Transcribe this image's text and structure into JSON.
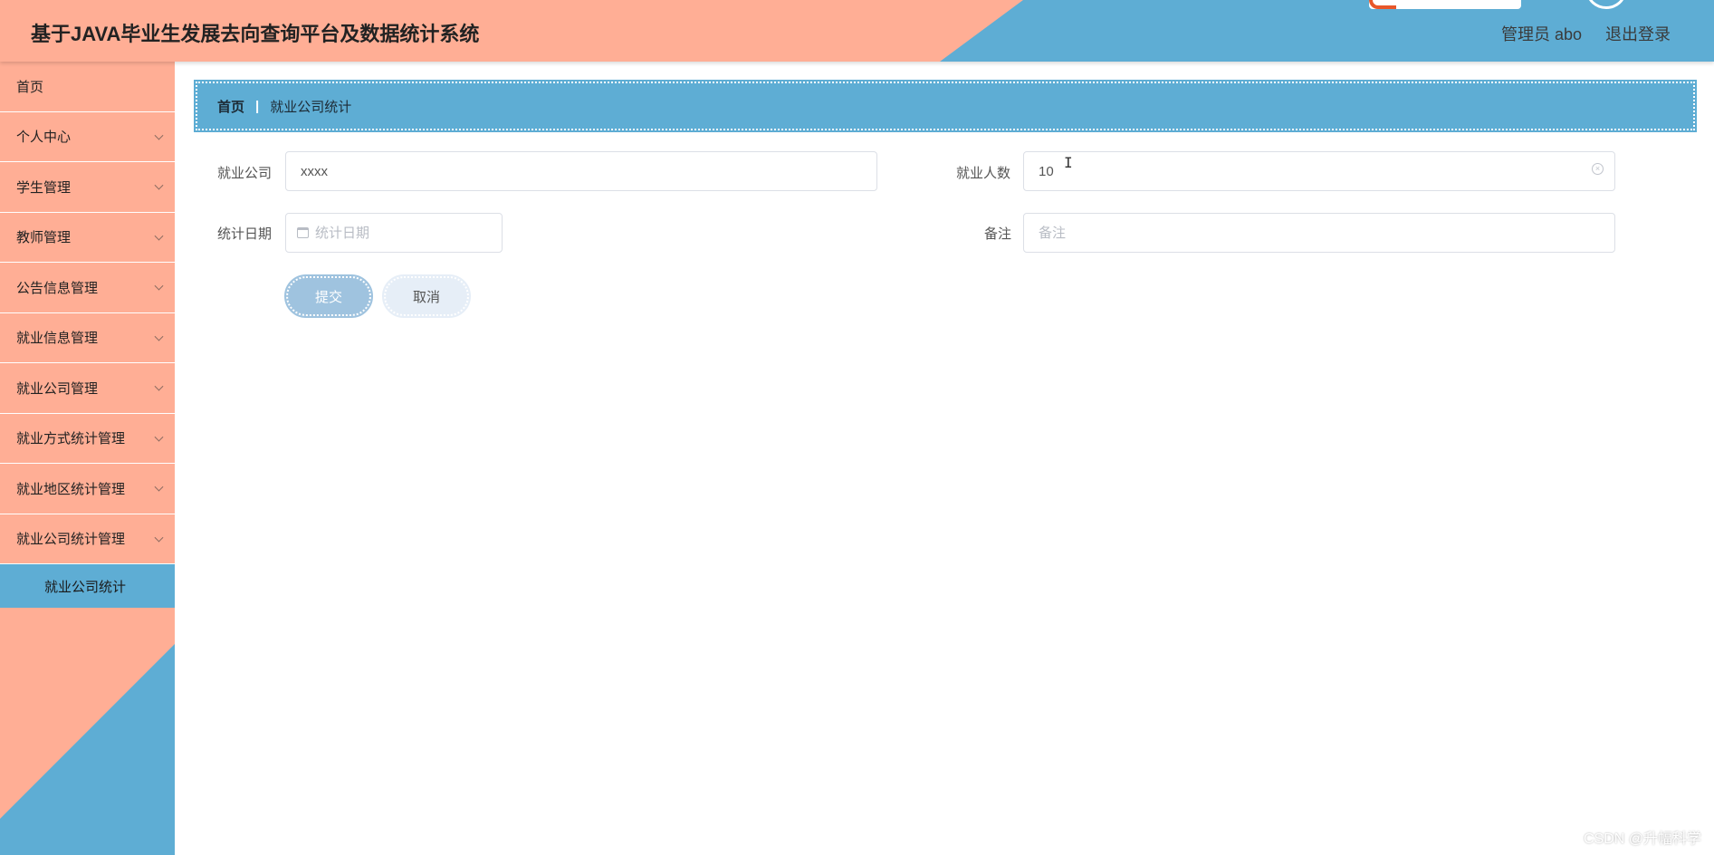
{
  "header": {
    "title": "基于JAVA毕业生发展去向查询平台及数据统计系统",
    "user_label": "管理员 abo",
    "logout_label": "退出登录"
  },
  "sidebar": {
    "items": [
      {
        "label": "首页",
        "has_chevron": false
      },
      {
        "label": "个人中心",
        "has_chevron": true
      },
      {
        "label": "学生管理",
        "has_chevron": true
      },
      {
        "label": "教师管理",
        "has_chevron": true
      },
      {
        "label": "公告信息管理",
        "has_chevron": true
      },
      {
        "label": "就业信息管理",
        "has_chevron": true
      },
      {
        "label": "就业公司管理",
        "has_chevron": true
      },
      {
        "label": "就业方式统计管理",
        "has_chevron": true
      },
      {
        "label": "就业地区统计管理",
        "has_chevron": true
      },
      {
        "label": "就业公司统计管理",
        "has_chevron": true
      }
    ],
    "active_subitem": "就业公司统计"
  },
  "breadcrumb": {
    "home": "首页",
    "separator": "|",
    "current": "就业公司统计"
  },
  "form": {
    "company_label": "就业公司",
    "company_value": "xxxx",
    "count_label": "就业人数",
    "count_value": "10",
    "date_label": "统计日期",
    "date_placeholder": "统计日期",
    "remark_label": "备注",
    "remark_placeholder": "备注",
    "submit_label": "提交",
    "cancel_label": "取消"
  },
  "icons": {
    "clear": "circle-x-icon",
    "calendar": "calendar-icon",
    "chevron": "chevron-down-icon",
    "cursor": "text-cursor-icon"
  },
  "colors": {
    "primary_blue": "#5eadd4",
    "salmon": "#ffae95",
    "submit_button": "#9fc3df",
    "cancel_button": "#e6eef7"
  },
  "watermark": "CSDN @升幅科学"
}
